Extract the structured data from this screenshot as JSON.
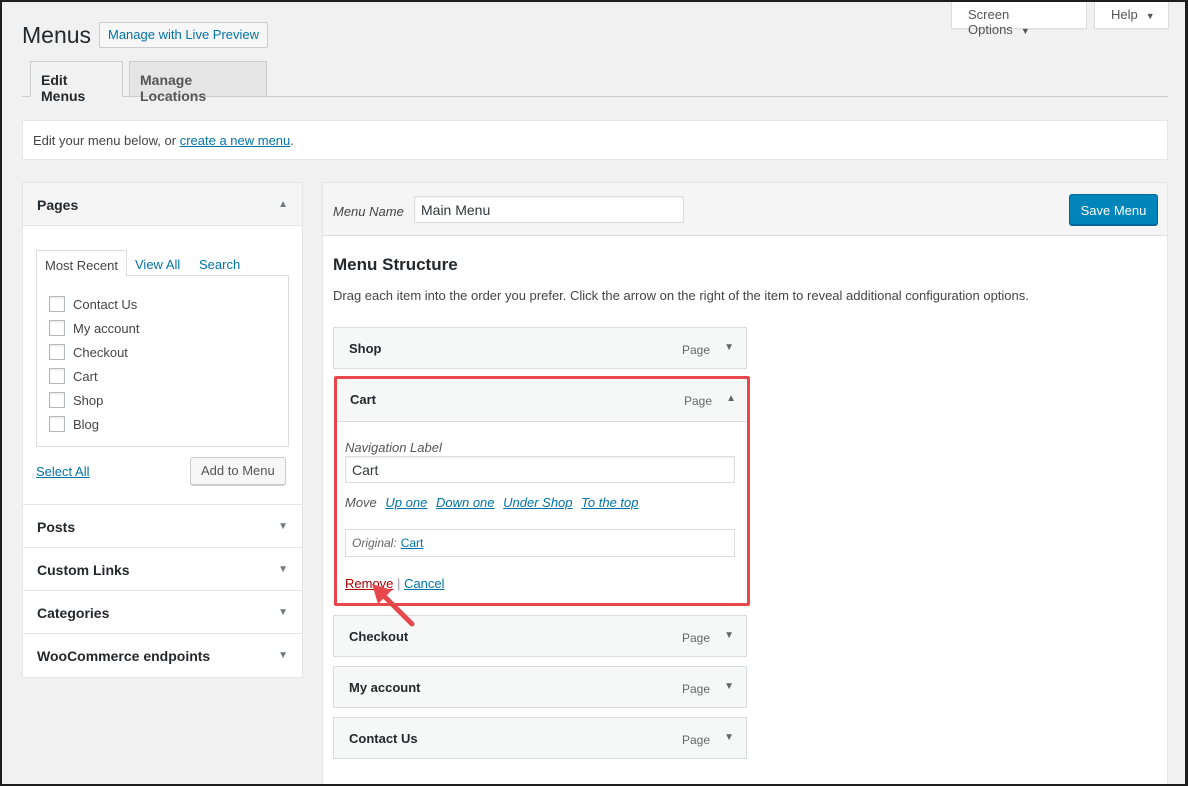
{
  "header": {
    "screen_options_label": "Screen Options",
    "help_label": "Help",
    "title": "Menus",
    "live_preview_label": "Manage with Live Preview"
  },
  "tabs": [
    {
      "label": "Edit Menus"
    },
    {
      "label": "Manage Locations"
    }
  ],
  "notice": {
    "text_before": "Edit your menu below, or ",
    "link": "create a new menu",
    "text_after": "."
  },
  "left_panel": {
    "pages": {
      "title": "Pages",
      "subtabs": [
        "Most Recent",
        "View All",
        "Search"
      ],
      "items": [
        "Contact Us",
        "My account",
        "Checkout",
        "Cart",
        "Shop",
        "Blog"
      ],
      "select_all": "Select All",
      "add_button": "Add to Menu"
    },
    "sections": [
      {
        "title": "Posts"
      },
      {
        "title": "Custom Links"
      },
      {
        "title": "Categories"
      },
      {
        "title": "WooCommerce endpoints"
      }
    ]
  },
  "menu": {
    "name_label": "Menu Name",
    "name_value": "Main Menu",
    "save_label": "Save Menu",
    "structure_title": "Menu Structure",
    "structure_desc": "Drag each item into the order you prefer. Click the arrow on the right of the item to reveal additional configuration options.",
    "items": [
      {
        "title": "Shop",
        "type": "Page"
      },
      {
        "title": "Cart",
        "type": "Page"
      },
      {
        "title": "Checkout",
        "type": "Page"
      },
      {
        "title": "My account",
        "type": "Page"
      },
      {
        "title": "Contact Us",
        "type": "Page"
      }
    ],
    "expanded": {
      "nav_label_caption": "Navigation Label",
      "nav_label_value": "Cart",
      "move_caption": "Move",
      "move_links": [
        "Up one",
        "Down one",
        "Under Shop",
        "To the top"
      ],
      "original_caption": "Original:",
      "original_link": "Cart",
      "remove_label": "Remove",
      "separator": "|",
      "cancel_label": "Cancel"
    }
  },
  "colors": {
    "accent": "#0073aa",
    "primary_button": "#0085ba",
    "highlight": "#e8474c",
    "remove": "#aa0000"
  }
}
